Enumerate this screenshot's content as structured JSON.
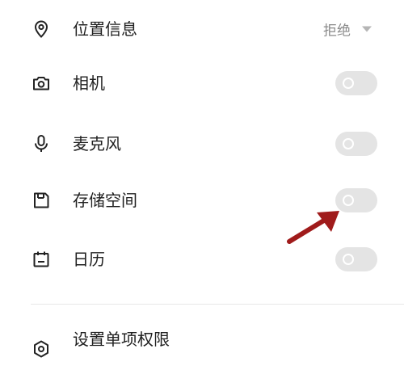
{
  "permissions": [
    {
      "label": "位置信息",
      "icon": "location-pin-icon",
      "control": "dropdown",
      "value": "拒绝"
    },
    {
      "label": "相机",
      "icon": "camera-icon",
      "control": "toggle",
      "enabled": false
    },
    {
      "label": "麦克风",
      "icon": "microphone-icon",
      "control": "toggle",
      "enabled": false
    },
    {
      "label": "存储空间",
      "icon": "storage-icon",
      "control": "toggle",
      "enabled": false
    },
    {
      "label": "日历",
      "icon": "calendar-icon",
      "control": "toggle",
      "enabled": false
    }
  ],
  "settings_item": {
    "label": "设置单项权限",
    "icon": "settings-icon"
  },
  "colors": {
    "toggle_off": "#e4e4e4",
    "annotation_arrow": "#a01b1b",
    "divider": "#e7e7e7"
  }
}
